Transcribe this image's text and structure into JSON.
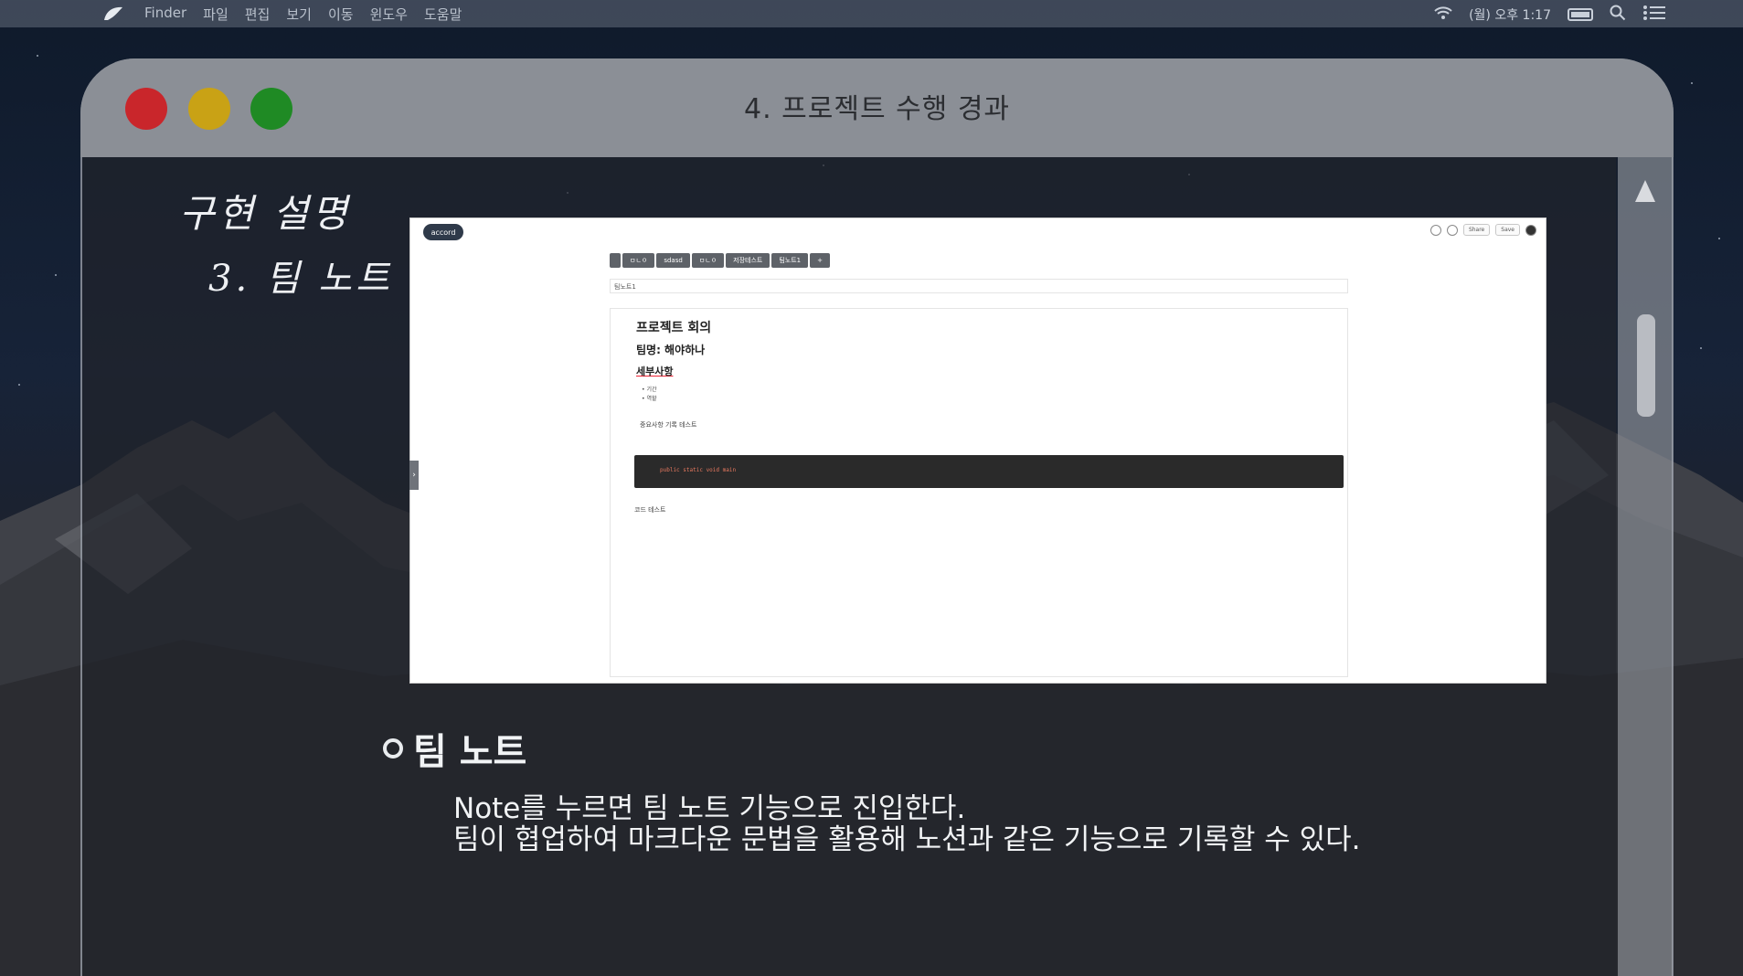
{
  "menubar": {
    "app": "Finder",
    "items": [
      "파일",
      "편집",
      "보기",
      "이동",
      "윈도우",
      "도움말"
    ],
    "clock": "(월) 오후 1:17"
  },
  "slide": {
    "title": "4. 프로젝트 수행 경과",
    "heading_line1": "구현 설명",
    "heading_line2": "3. 팀 노트",
    "section_title": "팀 노트",
    "description_line1": "Note를 누르면 팀 노트 기능으로 진입한다.",
    "description_line2": "팀이 협업하여 마크다운 문법을 활용해 노션과 같은 기능으로 기록할 수 있다."
  },
  "embedded_app": {
    "logo": "accord",
    "tabs": [
      "",
      "ㅁㄴㅇ",
      "sdasd",
      "ㅁㄴㅇ",
      "저장테스트",
      "팀노트1",
      "+"
    ],
    "top_buttons": [
      "Share",
      "Save"
    ],
    "page_name": "팀노트1",
    "note_h1": "프로젝트 회의",
    "note_h2": "팀명: 해야하나",
    "note_h3": "세부사항",
    "bullets": [
      "기간",
      "역할"
    ],
    "note_line": "중요사항 기록 테스트",
    "code": "public static void main",
    "code_caption": "코드 테스트",
    "side_handle": "›"
  },
  "colors": {
    "traffic_red": "#c9262b",
    "traffic_yellow": "#c9a215",
    "traffic_green": "#1f8a24",
    "titlebar": "#8b8f96"
  }
}
